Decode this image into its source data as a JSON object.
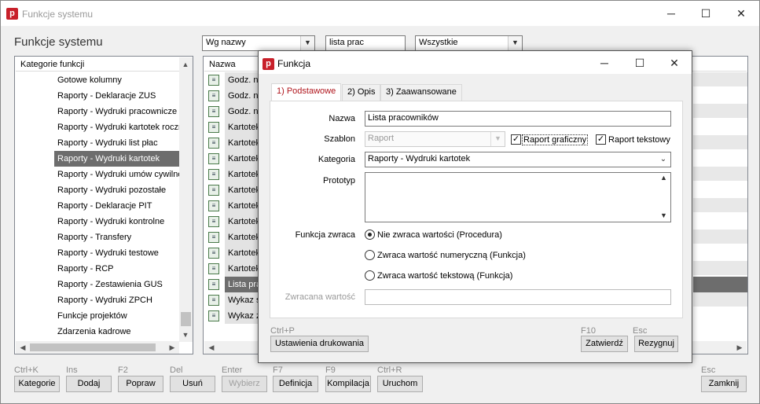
{
  "window": {
    "title": "Funkcje systemu",
    "icon_letter": "p",
    "accent": "#c8202a"
  },
  "heading": "Funkcje systemu",
  "filters": {
    "sort": "Wg nazwy",
    "search": "lista prac",
    "scope": "Wszystkie"
  },
  "categories": {
    "header": "Kategorie funkcji",
    "items": [
      "Gotowe kolumny",
      "Raporty - Deklaracje ZUS",
      "Raporty - Wydruki pracownicze",
      "Raporty - Wydruki kartotek roczn",
      "Raporty - Wydruki list płac",
      "Raporty - Wydruki kartotek",
      "Raporty - Wydruki umów cywilno",
      "Raporty - Wydruki pozostałe",
      "Raporty - Deklaracje PIT",
      "Raporty - Wydruki kontrolne",
      "Raporty - Transfery",
      "Raporty - Wydruki testowe",
      "Raporty - RCP",
      "Raporty - Zestawienia GUS",
      "Raporty - Wydruki ZPCH",
      "Funkcje projektów",
      "Zdarzenia kadrowe"
    ],
    "selected_index": 5
  },
  "functions": {
    "header": "Nazwa",
    "rows": [
      "Godz. na",
      "Godz. na",
      "Godz. na",
      "Kartotek",
      "Kartotek",
      "Kartotek",
      "Kartotek",
      "Kartotek",
      "Kartotek",
      "Kartotek",
      "Kartotek",
      "Kartotek",
      "Kartotek",
      "Lista pra",
      "Wykaz ś",
      "Wykaz z"
    ],
    "selected_index": 13
  },
  "bottom_bar": [
    {
      "key": "Ctrl+K",
      "label": "Kategorie",
      "disabled": false
    },
    {
      "key": "Ins",
      "label": "Dodaj",
      "disabled": false
    },
    {
      "key": "F2",
      "label": "Popraw",
      "disabled": false
    },
    {
      "key": "Del",
      "label": "Usuń",
      "disabled": false
    },
    {
      "key": "Enter",
      "label": "Wybierz",
      "disabled": true
    },
    {
      "key": "F7",
      "label": "Definicja",
      "disabled": false
    },
    {
      "key": "F9",
      "label": "Kompilacja",
      "disabled": false
    },
    {
      "key": "Ctrl+R",
      "label": "Uruchom",
      "disabled": false
    },
    {
      "key": "Esc",
      "label": "Zamknij",
      "disabled": false
    }
  ],
  "dialog": {
    "title": "Funkcja",
    "tabs": [
      "1) Podstawowe",
      "2) Opis",
      "3) Zaawansowane"
    ],
    "active_tab": 0,
    "labels": {
      "nazwa": "Nazwa",
      "szablon": "Szablon",
      "kategoria": "Kategoria",
      "prototyp": "Prototyp",
      "funkcja_zwraca": "Funkcja zwraca",
      "zwracana_wartosc": "Zwracana wartość"
    },
    "values": {
      "nazwa": "Lista pracowników",
      "szablon": "Raport",
      "kategoria": "Raporty - Wydruki kartotek",
      "prototyp": "",
      "zwracana_wartosc": ""
    },
    "checkboxes": {
      "raport_graficzny": "Raport graficzny",
      "raport_tekstowy": "Raport tekstowy"
    },
    "radios": [
      {
        "label": "Nie zwraca wartości (Procedura)",
        "checked": true
      },
      {
        "label": "Zwraca wartość numeryczną (Funkcja)",
        "checked": false
      },
      {
        "label": "Zwraca wartość tekstową (Funkcja)",
        "checked": false
      }
    ],
    "buttons": {
      "print_key": "Ctrl+P",
      "print_label": "Ustawienia drukowania",
      "ok_key": "F10",
      "ok_label": "Zatwierdź",
      "cancel_key": "Esc",
      "cancel_label": "Rezygnuj"
    }
  }
}
